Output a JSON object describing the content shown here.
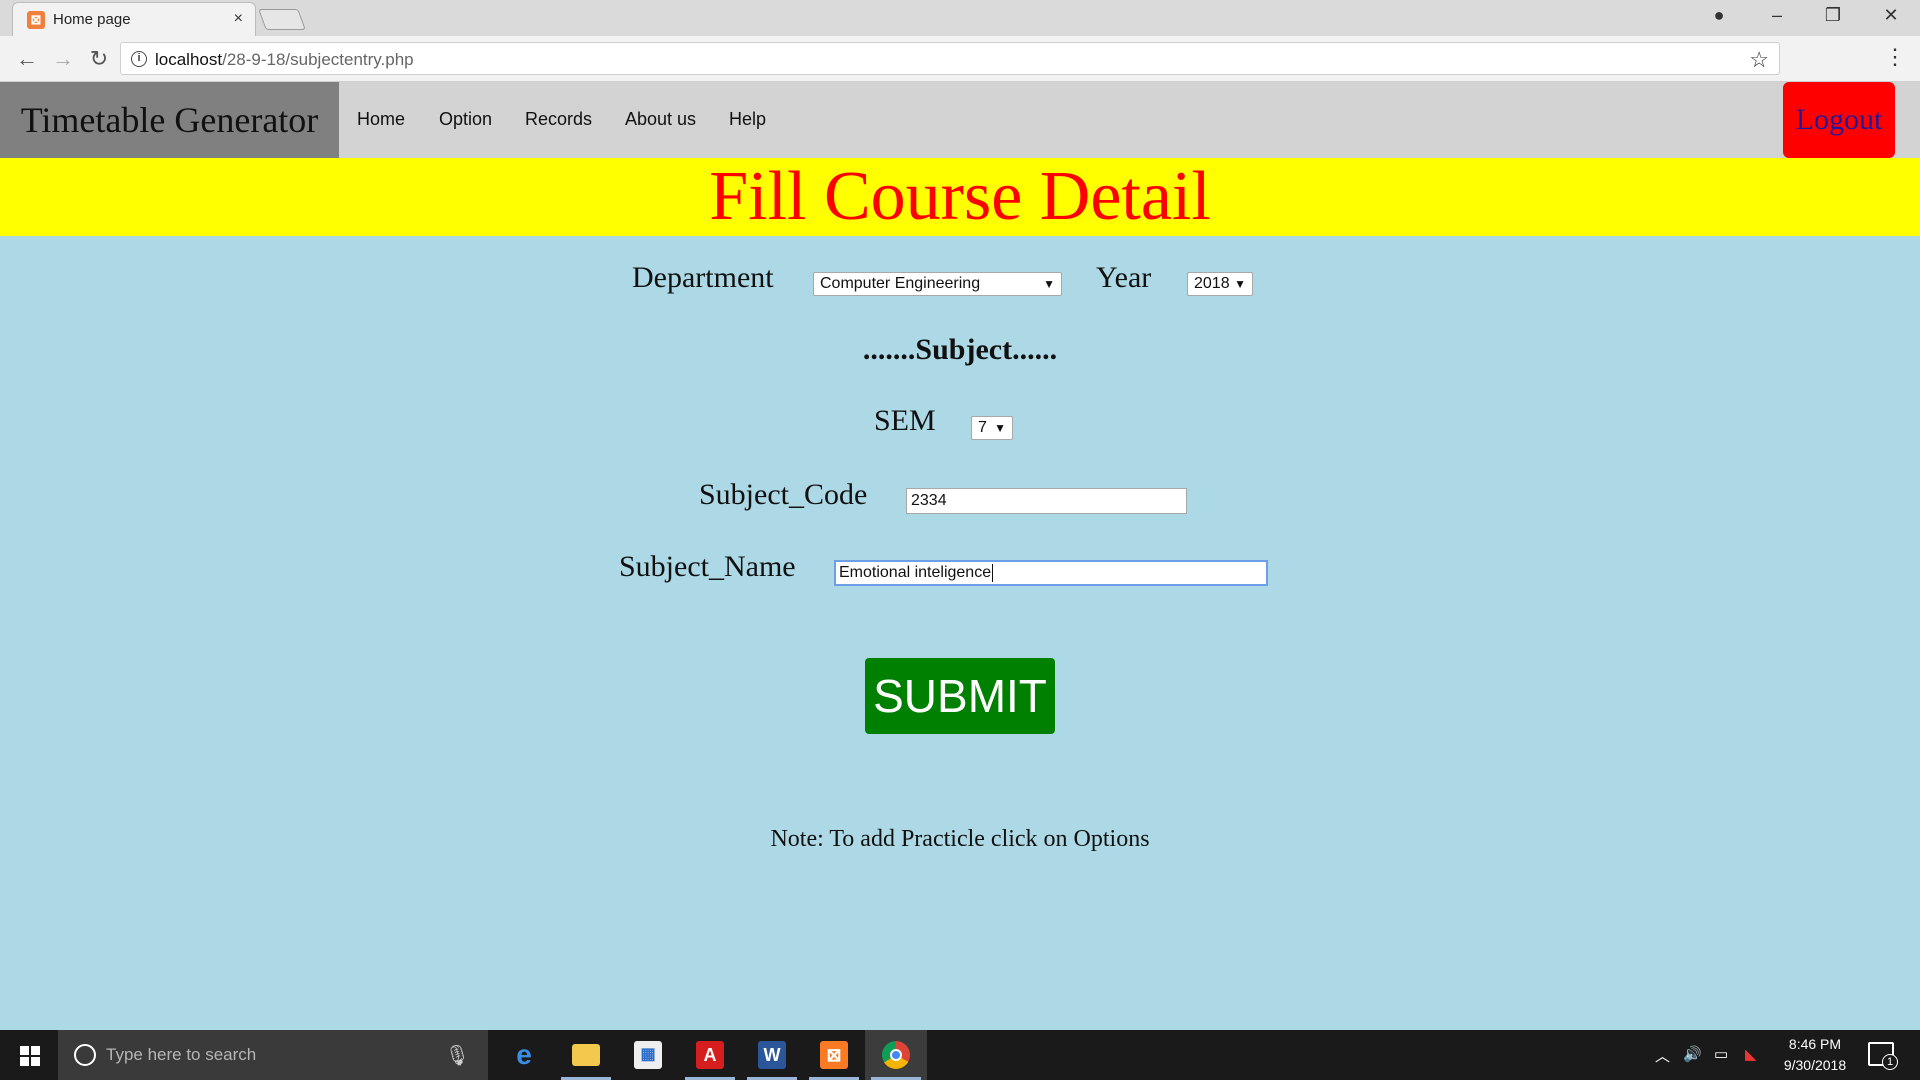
{
  "browser": {
    "tab_title": "Home page",
    "tab_close": "×",
    "url_host": "localhost",
    "url_path": "/28-9-18/subjectentry.php",
    "favicon": "xampp-icon"
  },
  "site": {
    "brand": "Timetable Generator",
    "nav": [
      "Home",
      "Option",
      "Records",
      "About us",
      "Help"
    ],
    "logout": "Logout"
  },
  "banner": {
    "title": "Fill Course Detail"
  },
  "form": {
    "department_label": "Department",
    "department_value": "Computer Engineering",
    "year_label": "Year",
    "year_value": "2018",
    "subject_heading": ".......Subject......",
    "sem_label": "SEM",
    "sem_value": "7",
    "subject_code_label": "Subject_Code",
    "subject_code_value": "2334",
    "subject_name_label": "Subject_Name",
    "subject_name_value": "Emotional inteligence",
    "submit_label": "SUBMIT",
    "note": "Note: To add Practicle click on Options"
  },
  "taskbar": {
    "search_placeholder": "Type here to search",
    "apps": [
      "edge-icon",
      "file-explorer-icon",
      "store-icon",
      "acrobat-icon",
      "word-icon",
      "xampp-icon",
      "chrome-icon"
    ],
    "time": "8:46 PM",
    "date": "9/30/2018",
    "notification_count": "1"
  },
  "colors": {
    "page_bg": "#add8e6",
    "banner_bg": "#ffff00",
    "banner_text": "#ff0000",
    "logout_bg": "#ff0000",
    "submit_bg": "#008000",
    "brand_bg": "#808080",
    "nav_bg": "#d3d3d3"
  }
}
